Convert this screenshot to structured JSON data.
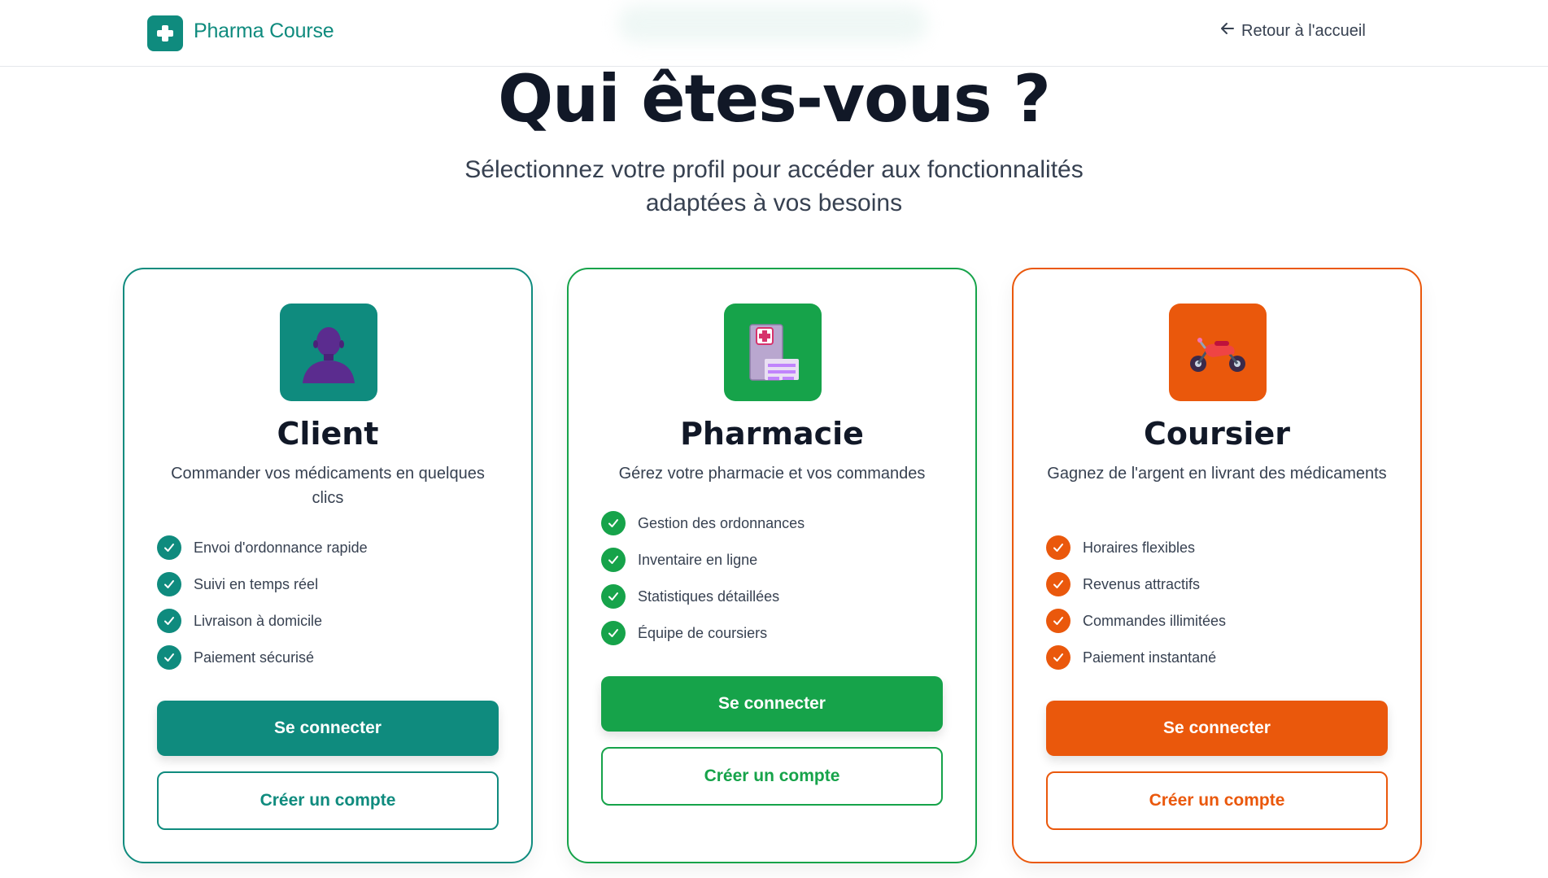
{
  "header": {
    "brand": "Pharma Course",
    "back_label": "Retour à l'accueil"
  },
  "page": {
    "title": "Qui êtes-vous ?",
    "subtitle_line1": "Sélectionnez votre profil pour accéder aux fonctionnalités",
    "subtitle_line2": "adaptées à vos besoins"
  },
  "colors": {
    "teal": "#0f8b7e",
    "green": "#16a34a",
    "orange": "#ea580c"
  },
  "cards": [
    {
      "title": "Client",
      "icon": "person-icon",
      "description": "Commander vos médicaments en quelques clics",
      "features": [
        "Envoi d'ordonnance rapide",
        "Suivi en temps réel",
        "Livraison à domicile",
        "Paiement sécurisé"
      ],
      "login_label": "Se connecter",
      "register_label": "Créer un compte"
    },
    {
      "title": "Pharmacie",
      "icon": "hospital-icon",
      "description": "Gérez votre pharmacie et vos commandes",
      "features": [
        "Gestion des ordonnances",
        "Inventaire en ligne",
        "Statistiques détaillées",
        "Équipe de coursiers"
      ],
      "login_label": "Se connecter",
      "register_label": "Créer un compte"
    },
    {
      "title": "Coursier",
      "icon": "motorcycle-icon",
      "description": "Gagnez de l'argent en livrant des médicaments",
      "features": [
        "Horaires flexibles",
        "Revenus attractifs",
        "Commandes illimitées",
        "Paiement instantané"
      ],
      "login_label": "Se connecter",
      "register_label": "Créer un compte"
    }
  ]
}
